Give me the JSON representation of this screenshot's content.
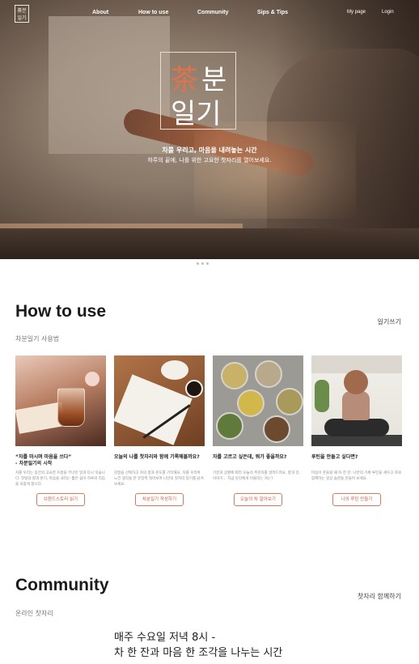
{
  "header": {
    "logo_text": "茶분\n일기",
    "nav": [
      "About",
      "How to use",
      "Community",
      "Sips & Tips"
    ],
    "my_page": "My page",
    "login": "Login"
  },
  "hero": {
    "title_accent": "茶",
    "title_a": "분",
    "title_b": "일기",
    "subtitle1": "차를 우리고, 마음을 내려놓는 시간",
    "subtitle2": "하루의 끝에, 나를 위한 고요한 찻자리를 열어보세요."
  },
  "how_to_use": {
    "title": "How to use",
    "subtitle": "차분일기 사용법",
    "link": "일기쓰기",
    "cards": [
      {
        "title_line1": "“차를 마시며 마음을 쓰다”",
        "title_line2": "- 차분일기의 시작",
        "desc": "차를 우리는 동안의 고요한 흐름을 무너진 일과 다시 잇습니다. 찻잎의 향과 온기, 마음을 내리는 짧은 쉼이 하루의 리듬을 되찾게 합니다.",
        "button": "브랜드스토리 읽기"
      },
      {
        "title_line1": "오늘의 나를 찻자리와 함께 기록해볼까요?",
        "title_line2": "",
        "desc": "감정을 선택하고 차의 향과 온도를 기억해요. 차를 우리며 느낀 생각을 한 문장씩 적어보며 나만의 찻자리 일기를 남겨보세요.",
        "button": "차분일기 작성하기"
      },
      {
        "title_line1": "차를 고르고 싶은데, 뭐가 좋을까요?",
        "title_line2": "",
        "desc": "기분과 상황에 따라 오늘의 추천차를 알려드려요. 향과 맛, 이야기... 지금 당신에게 어울리는 차는?",
        "button": "오늘의 차 알아보기"
      },
      {
        "title_line1": "루틴을 만들고 싶다면?",
        "title_line2": "",
        "desc": "마음이 흔들릴 때 차 한 잔. 나만의 기록 루틴을 세우고 차와 함께하는 일상 습관을 만들어 보세요.",
        "button": "나의 루틴 만들기"
      }
    ]
  },
  "community": {
    "title": "Community",
    "subtitle": "온라인 찻자리",
    "link": "찻자리 함께하기",
    "line1": "매주 수요일 저녁 8시 -",
    "line2": "차 한 잔과 마음 한 조각을 나누는 시간"
  }
}
